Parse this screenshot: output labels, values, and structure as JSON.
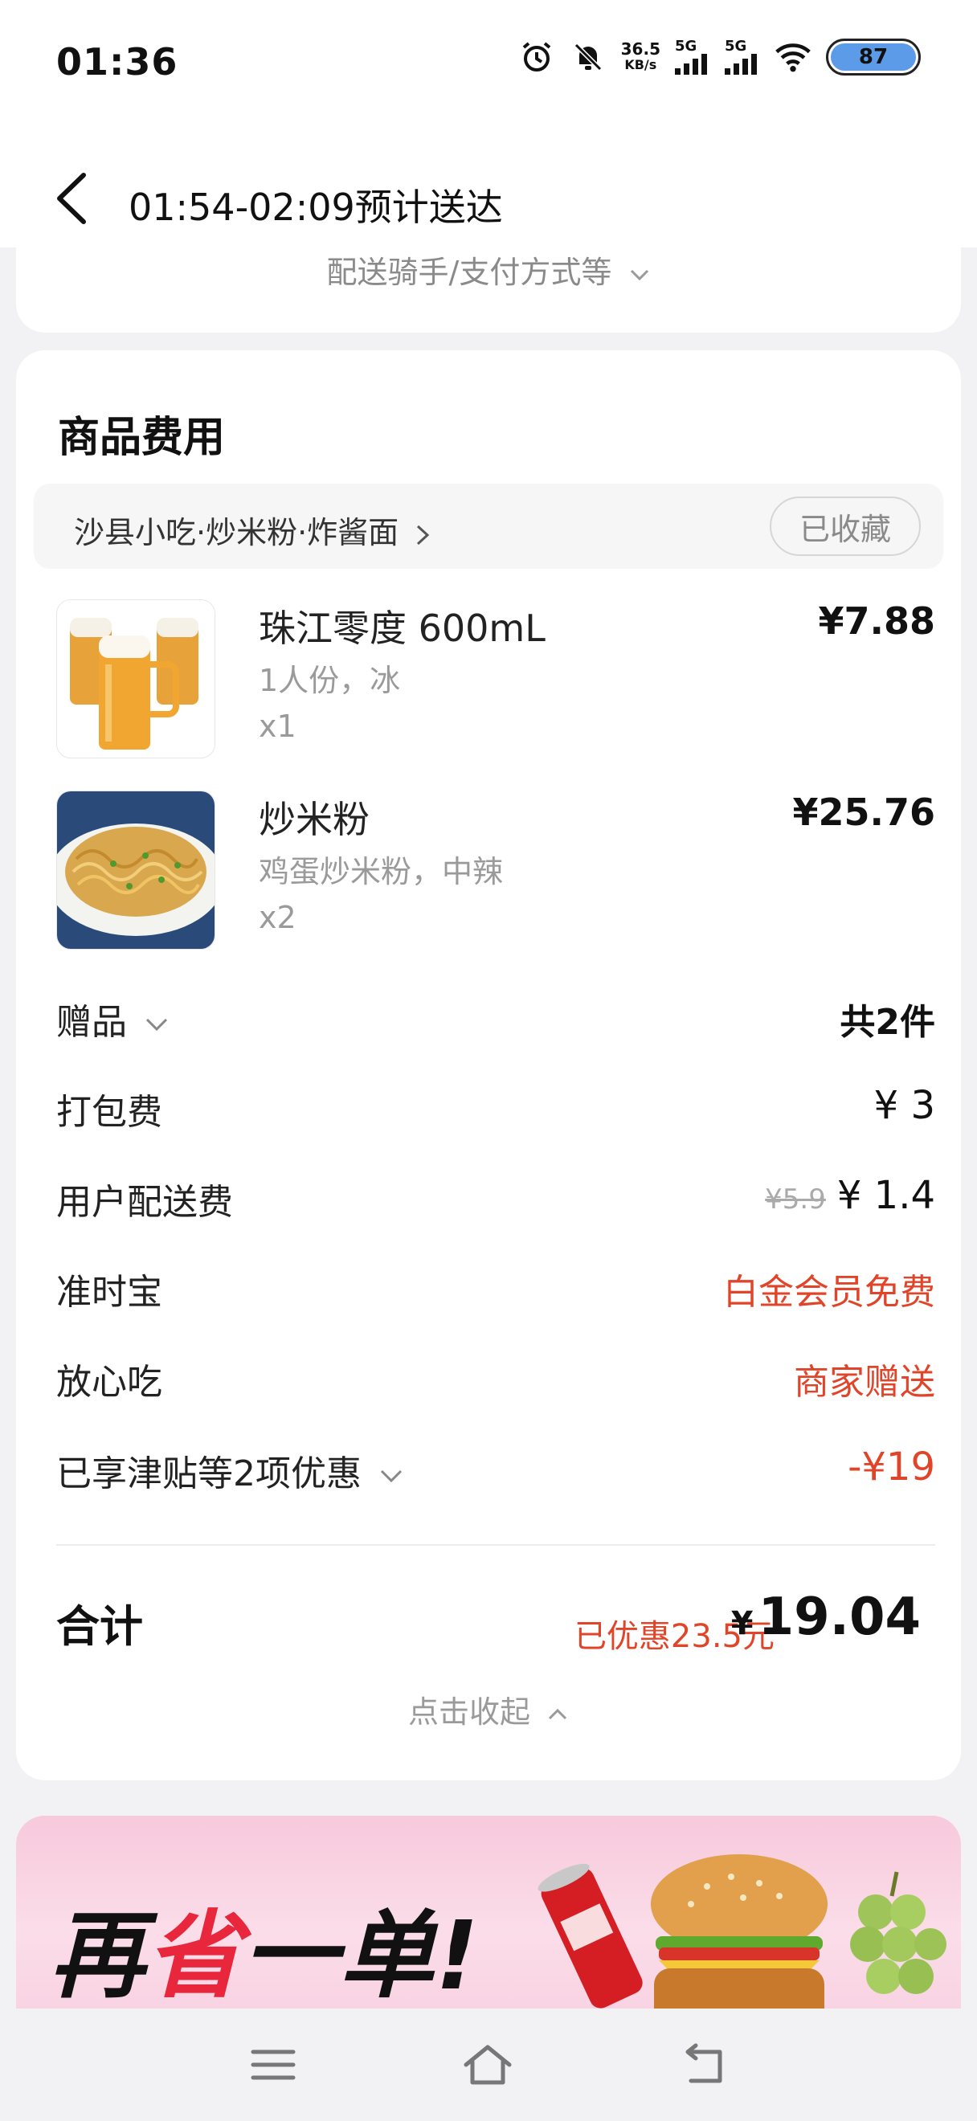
{
  "status_bar": {
    "time": "01:36",
    "net_speed_value": "36.5",
    "net_speed_unit": "KB/s",
    "signal1": "5G",
    "signal2": "5G",
    "battery": "87",
    "icons": [
      "alarm-icon",
      "mute-icon",
      "signal-icon",
      "signal-icon",
      "wifi-icon",
      "battery-icon"
    ]
  },
  "header": {
    "title": "01:54-02:09预计送达"
  },
  "delivery": {
    "link_label": "配送骑手/支付方式等"
  },
  "fees": {
    "section_title": "商品费用",
    "shop_name": "沙县小吃·炒米粉·炸酱面",
    "favorite_label": "已收藏",
    "items": [
      {
        "name": "珠江零度 600mL",
        "spec": "1人份，冰",
        "qty": "x1",
        "price": "¥7.88"
      },
      {
        "name": "炒米粉",
        "spec": "鸡蛋炒米粉，中辣",
        "qty": "x2",
        "price": "¥25.76"
      }
    ],
    "rows": {
      "gift_label": "赠品",
      "gift_value": "共2件",
      "packing_label": "打包费",
      "packing_value": "¥ 3",
      "delivery_label": "用户配送费",
      "delivery_original": "¥5.9",
      "delivery_value": "¥ 1.4",
      "ontime_label": "准时宝",
      "ontime_value": "白金会员免费",
      "safe_label": "放心吃",
      "safe_value": "商家赠送",
      "discount_label": "已享津贴等2项优惠",
      "discount_value": "-¥19"
    },
    "total_label": "合计",
    "saved_text": "已优惠23.5元",
    "total_currency": "¥",
    "total_value": "19.04",
    "collapse_label": "点击收起"
  },
  "banner": {
    "text_part1": "再",
    "text_part2": "省",
    "text_part3": "一单!"
  },
  "colors": {
    "accent_red": "#e0452a",
    "banner_red": "#e8263c",
    "battery_blue": "#5b9be8"
  }
}
